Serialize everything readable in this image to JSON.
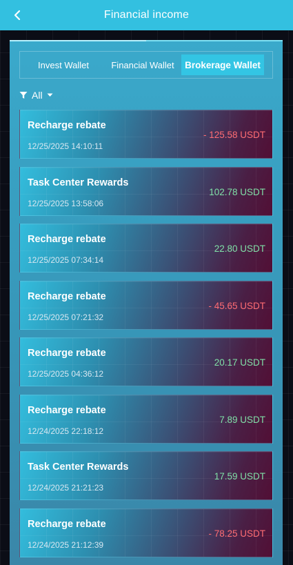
{
  "header": {
    "title": "Financial income"
  },
  "tabs": [
    {
      "label": "Invest Wallet",
      "active": false
    },
    {
      "label": "Financial Wallet",
      "active": false
    },
    {
      "label": "Brokerage Wallet",
      "active": true
    }
  ],
  "filter": {
    "label": "All",
    "icon": "filter-icon"
  },
  "colors": {
    "header": "#33c0e0",
    "negative": "#ff6b72",
    "positive": "#7fe0a6"
  },
  "records": [
    {
      "title": "Recharge rebate",
      "time": "12/25/2025 14:10:11",
      "amount": "- 125.58 USDT",
      "sign": "negative"
    },
    {
      "title": "Task Center Rewards",
      "time": "12/25/2025 13:58:06",
      "amount": "102.78 USDT",
      "sign": "positive"
    },
    {
      "title": "Recharge rebate",
      "time": "12/25/2025 07:34:14",
      "amount": "22.80 USDT",
      "sign": "positive"
    },
    {
      "title": "Recharge rebate",
      "time": "12/25/2025 07:21:32",
      "amount": "- 45.65 USDT",
      "sign": "negative"
    },
    {
      "title": "Recharge rebate",
      "time": "12/25/2025 04:36:12",
      "amount": "20.17 USDT",
      "sign": "positive"
    },
    {
      "title": "Recharge rebate",
      "time": "12/24/2025 22:18:12",
      "amount": "7.89 USDT",
      "sign": "positive"
    },
    {
      "title": "Task Center Rewards",
      "time": "12/24/2025 21:21:23",
      "amount": "17.59 USDT",
      "sign": "positive"
    },
    {
      "title": "Recharge rebate",
      "time": "12/24/2025 21:12:39",
      "amount": "- 78.25 USDT",
      "sign": "negative"
    }
  ]
}
